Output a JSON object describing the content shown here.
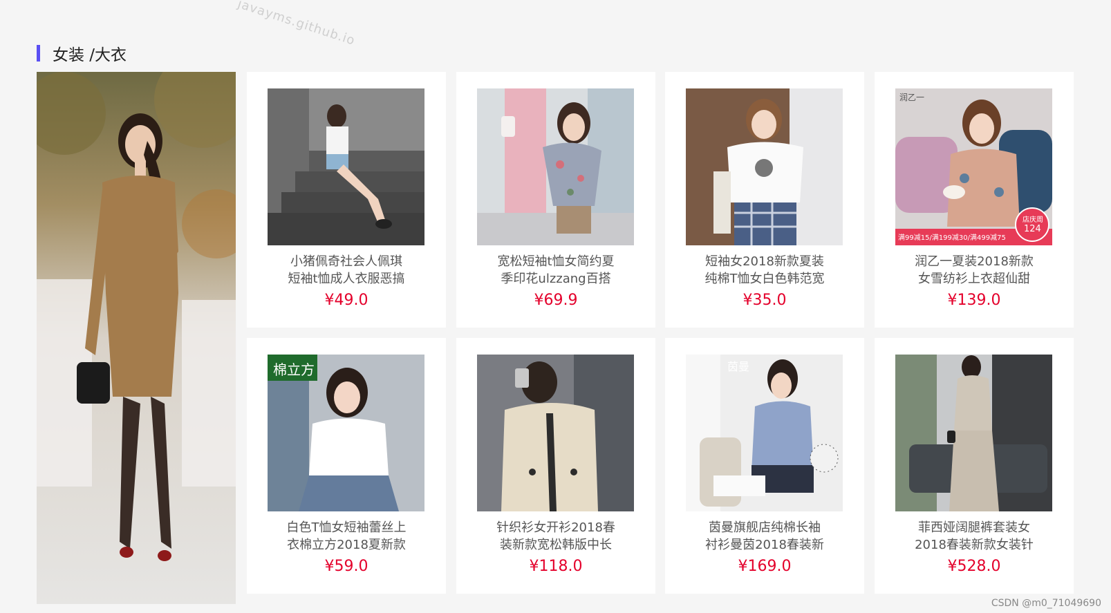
{
  "watermark": "javayms.github.io",
  "section": {
    "title": "女装 /大衣",
    "accent_color": "#5a4ff3"
  },
  "banner": {
    "image": "woman-in-beige-dress-photo"
  },
  "products": [
    {
      "name_line1": "小猪佩奇社会人佩琪",
      "name_line2": "短袖t恤成人衣服恶搞",
      "price": "¥49.0",
      "image": "girl-sitting-on-stairs-photo"
    },
    {
      "name_line1": "宽松短袖t恤女简约夏",
      "name_line2": "季印花ulzzang百搭",
      "price": "¥69.9",
      "image": "floral-blouse-photo"
    },
    {
      "name_line1": "短袖女2018新款夏装",
      "name_line2": "纯棉T恤女白色韩范宽",
      "price": "¥35.0",
      "image": "white-tshirt-plaid-skirt-photo"
    },
    {
      "name_line1": "润乙一夏装2018新款",
      "name_line2": "女雪纺衫上衣超仙甜",
      "price": "¥139.0",
      "image": "chiffon-top-coffee-photo",
      "overlay_brand": "润乙一",
      "overlay_promo": "满99减15/满199减30/满499减75",
      "overlay_badge_line1": "店庆周",
      "overlay_badge_price": "124"
    },
    {
      "name_line1": "白色T恤女短袖蕾丝上",
      "name_line2": "衣棉立方2018夏新款",
      "price": "¥59.0",
      "image": "white-lace-tee-photo",
      "overlay_brand": "棉立方"
    },
    {
      "name_line1": "针织衫女开衫2018春",
      "name_line2": "装新款宽松韩版中长",
      "price": "¥118.0",
      "image": "knit-cardigan-selfie-photo"
    },
    {
      "name_line1": "茵曼旗舰店纯棉长袖",
      "name_line2": "衬衫曼茵2018春装新",
      "price": "¥169.0",
      "image": "blue-shirt-reading-photo",
      "overlay_brand": "茵曼"
    },
    {
      "name_line1": "菲西娅阔腿裤套装女",
      "name_line2": "2018春装新款女装针",
      "price": "¥528.0",
      "image": "wide-leg-pants-set-photo"
    }
  ],
  "credit": "CSDN @m0_71049690"
}
